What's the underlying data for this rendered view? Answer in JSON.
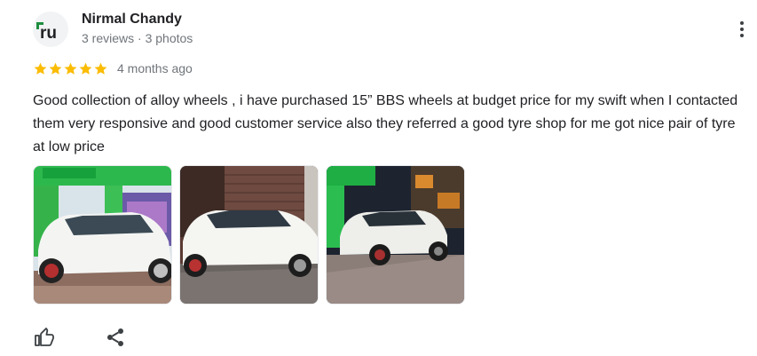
{
  "review": {
    "author": {
      "name": "Nirmal Chandy",
      "meta": "3 reviews · 3 photos",
      "avatar_text": "ru"
    },
    "rating": 5,
    "date": "4 months ago",
    "text": "Good collection of alloy wheels , i have purchased 15” BBS wheels at budget price for my swift when I contacted them very responsive and good customer service also they referred a good tyre shop for me got nice pair of tyre at low price",
    "photos": [
      {
        "icon": "car-photo-fuel-station"
      },
      {
        "icon": "car-photo-shutter"
      },
      {
        "icon": "car-photo-night-street"
      }
    ],
    "actions": {
      "like_icon": "thumbs-up-icon",
      "share_icon": "share-icon"
    },
    "colors": {
      "star": "#fbbc04",
      "avatar_accent": "#1e8e3e",
      "text": "#202124",
      "secondary": "#70757a"
    }
  }
}
